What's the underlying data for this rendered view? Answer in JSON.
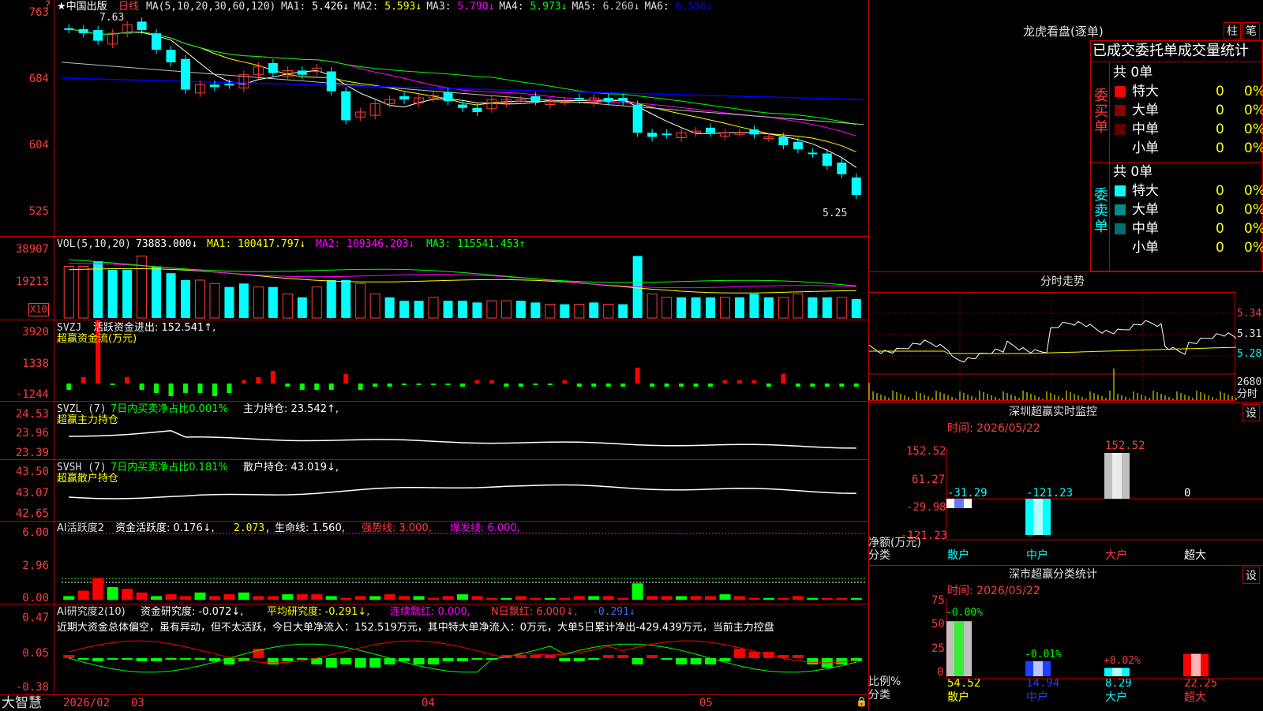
{
  "header": {
    "stock_name": "★中国出版",
    "period": "日线",
    "ma_params": "MA(5,10,20,30,60,120)",
    "ma_values": [
      {
        "label": "MA1:",
        "value": "5.426↓",
        "color": "#ffffff"
      },
      {
        "label": "MA2:",
        "value": "5.593↓",
        "color": "#ffff00"
      },
      {
        "label": "MA3:",
        "value": "5.790↓",
        "color": "#ff00ff"
      },
      {
        "label": "MA4:",
        "value": "5.973↓",
        "color": "#00ff00"
      },
      {
        "label": "MA5:",
        "value": "6.260↓",
        "color": "#c0c0c0"
      },
      {
        "label": "MA6:",
        "value": "6.556↓",
        "color": "#0000ff"
      }
    ],
    "corner_mark": "?"
  },
  "main_axis": [
    "763",
    "684",
    "604",
    "525"
  ],
  "annotations": {
    "high": "7.63",
    "low": "5.25"
  },
  "vol": {
    "title": "VOL(5,10,20)",
    "value": "73883.000↓",
    "ma1": "MA1: 100417.797↓",
    "ma2": "MA2: 109346.203↓",
    "ma3": "MA3: 115541.453↑",
    "axis": [
      "38907",
      "19213"
    ],
    "multiplier": "X10"
  },
  "svzj": {
    "title": "SVZJ",
    "l1": "活跃资金进出: 152.541↑,",
    "l2": "超赢资金流(万元)",
    "axis": [
      "3920",
      "1338",
      "-1244"
    ]
  },
  "svzl": {
    "title": "SVZL (7)",
    "l1": "7日内买卖净占比0.001%",
    "l2": "主力持仓: 23.542↑,",
    "l3": "超赢主力持仓",
    "axis": [
      "24.53",
      "23.96",
      "23.39"
    ]
  },
  "svsh": {
    "title": "SVSH (7)",
    "l1": "7日内买卖净占比0.181%",
    "l2": "散户持仓: 43.019↓,",
    "l3": "超赢散户持仓",
    "axis": [
      "43.50",
      "43.07",
      "42.65"
    ]
  },
  "ai_active": {
    "title": "AI活跃度2",
    "l1": "资金活跃度: 0.176↓,",
    "l2": "2.073,",
    "l3": "生命线: 1.560,",
    "l4": "强势线: 3.000,",
    "l5": "爆发线: 6.000,",
    "axis": [
      "6.00",
      "2.96",
      "0.00"
    ]
  },
  "ai_research": {
    "title": "AI研究度2(10)",
    "l1": "资金研究度: -0.072↓,",
    "l2": "平均研究度: -0.291↓,",
    "l3": "连续飘红: 0.000,",
    "l4": "N日飘红: 6.000↓,",
    "l5": "-0.291↓",
    "comment": "近期大资金总体偏空，虽有异动，但不太活跃，今日大单净流入：152.519万元，其中特大单净流入：0万元，大单5日累计净出-429.439万元，当前主力控盘",
    "axis": [
      "0.47",
      "0.05",
      "-0.38"
    ]
  },
  "bottom": {
    "logo": "大智慧",
    "dates": [
      "2026/02",
      "03",
      "04",
      "05"
    ]
  },
  "dragon": {
    "title": "龙虎看盘(逐单)",
    "btn_bar": "柱",
    "btn_pen": "笔",
    "tabs": "已成交委托单成交量统计",
    "buy": {
      "side": "委买单",
      "total": "共 0单",
      "rows": [
        {
          "name": "特大",
          "n": "0",
          "p": "0%",
          "color": "#ff0000"
        },
        {
          "name": "大单",
          "n": "0",
          "p": "0%",
          "color": "#8b0000"
        },
        {
          "name": "中单",
          "n": "0",
          "p": "0%",
          "color": "#600000"
        },
        {
          "name": "小单",
          "n": "0",
          "p": "0%",
          "color": "#000000"
        }
      ]
    },
    "sell": {
      "side": "委卖单",
      "total": "共 0单",
      "rows": [
        {
          "name": "特大",
          "n": "0",
          "p": "0%",
          "color": "#00ffff"
        },
        {
          "name": "大单",
          "n": "0",
          "p": "0%",
          "color": "#008b8b"
        },
        {
          "name": "中单",
          "n": "0",
          "p": "0%",
          "color": "#007070"
        },
        {
          "name": "小单",
          "n": "0",
          "p": "0%",
          "color": "#000000"
        }
      ]
    }
  },
  "intraday": {
    "title": "分时走势",
    "axis": [
      "5.34",
      "5.31",
      "5.28"
    ],
    "vol_axis": "2680",
    "unit": "分时"
  },
  "sz_monitor": {
    "title": "深圳超赢实时监控",
    "btn": "设",
    "time": "时间: 2026/05/22",
    "axis": [
      "152.52",
      "61.27",
      "-29.98",
      "-121.23"
    ],
    "ylabel": "净额(万元)",
    "xlabel": "分类",
    "bars": [
      {
        "name": "散户",
        "value": "-31.29",
        "v": -31.29
      },
      {
        "name": "中户",
        "value": "-121.23",
        "v": -121.23
      },
      {
        "name": "大户",
        "value": "152.52",
        "v": 152.52
      },
      {
        "name": "超大",
        "value": "0",
        "v": 0
      }
    ]
  },
  "sz_stats": {
    "title": "深市超赢分类统计",
    "btn": "设",
    "time": "时间: 2026/05/22",
    "axis": [
      "75",
      "50",
      "25",
      "0"
    ],
    "ylabel": "比例%",
    "xlabel": "分类",
    "bars": [
      {
        "name": "散户",
        "value": "54.52",
        "pct": 54.52,
        "chg": "-0.00%"
      },
      {
        "name": "中户",
        "value": "14.94",
        "pct": 14.94,
        "chg": "-0.01%"
      },
      {
        "name": "大户",
        "value": "8.29",
        "pct": 8.29,
        "chg": "+0.02%"
      },
      {
        "name": "超大",
        "value": "22.25",
        "pct": 22.25,
        "chg": ""
      }
    ]
  },
  "chart_data": {
    "type": "candlestick",
    "title": "中国出版 日线",
    "price_range": [
      5.25,
      7.63
    ],
    "closes": [
      7.45,
      7.4,
      7.31,
      7.4,
      7.5,
      7.44,
      7.2,
      7.05,
      6.72,
      6.78,
      6.75,
      6.78,
      6.9,
      7.0,
      6.92,
      6.95,
      6.9,
      6.98,
      6.7,
      6.35,
      6.45,
      6.55,
      6.6,
      6.6,
      6.62,
      6.65,
      6.58,
      6.5,
      6.45,
      6.6,
      6.6,
      6.6,
      6.58,
      6.58,
      6.58,
      6.6,
      6.62,
      6.58,
      6.58,
      6.2,
      6.15,
      6.18,
      6.2,
      6.22,
      6.2,
      6.2,
      6.2,
      6.18,
      6.15,
      6.05,
      6.0,
      5.95,
      5.8,
      5.7,
      5.45
    ]
  }
}
